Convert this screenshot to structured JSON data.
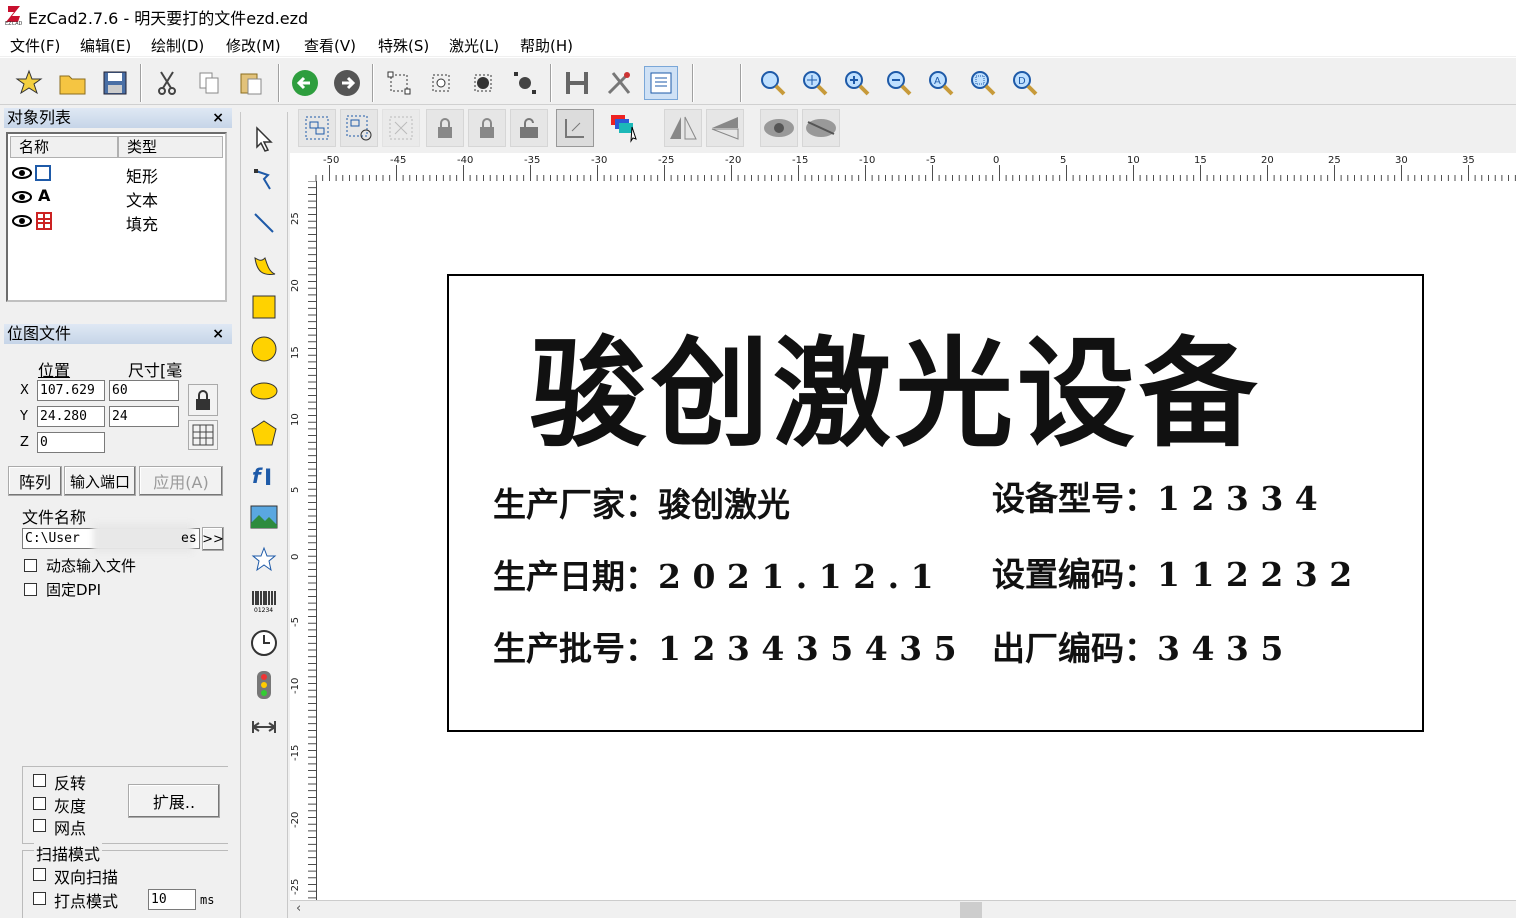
{
  "window": {
    "title": "EzCad2.7.6 - 明天要打的文件ezd.ezd"
  },
  "menu": [
    "文件(F)",
    "编辑(E)",
    "绘制(D)",
    "修改(M)",
    "查看(V)",
    "特殊(S)",
    "激光(L)",
    "帮助(H)"
  ],
  "object_panel": {
    "title": "对象列表",
    "col_name": "名称",
    "col_type": "类型",
    "rows": [
      {
        "icon": "rectangle-icon",
        "type": "矩形"
      },
      {
        "icon": "text-A-icon",
        "type": "文本"
      },
      {
        "icon": "fill-icon",
        "type": "填充"
      }
    ]
  },
  "bitmap_panel": {
    "title": "位图文件",
    "pos_label": "位置",
    "size_label": "尺寸[毫",
    "x_label": "X",
    "y_label": "Y",
    "z_label": "Z",
    "x_pos": "107.629",
    "y_pos": "24.280",
    "z_pos": "0",
    "x_size": "60",
    "y_size": "24",
    "btn_array": "阵列",
    "btn_input_port": "输入端口",
    "btn_apply": "应用(A)",
    "file_name_label": "文件名称",
    "file_path": "C:\\User",
    "file_path_tail": "es",
    "browse": ">>",
    "dynamic_input": "动态输入文件",
    "fixed_dpi": "固定DPI",
    "invert": "反转",
    "gray": "灰度",
    "dither": "网点",
    "btn_expand": "扩展..",
    "scan_mode_label": "扫描模式",
    "bidirectional": "双向扫描",
    "dot_mode": "打点模式",
    "dot_ms_value": "10",
    "ms_unit": "ms"
  },
  "ruler": {
    "h_ticks": [
      "-50",
      "-45",
      "-40",
      "-35",
      "-30",
      "-25",
      "-20",
      "-15",
      "-10",
      "-5",
      "0",
      "5",
      "10",
      "15",
      "20",
      "25",
      "30",
      "35"
    ],
    "v_ticks": [
      "25",
      "20",
      "15",
      "10",
      "5",
      "0",
      "-5",
      "-10",
      "-15",
      "-20",
      "-25"
    ]
  },
  "label_content": {
    "heading": "骏创激光设备",
    "line1_left": "生产厂家：骏创激光",
    "line1_right": "设备型号：1 2 3 3 4",
    "line2_left": "生产日期：2 0 2 1 . 1 2 . 1",
    "line2_right": "设置编码：1 1 2 2 3 2",
    "line3_left": "生产批号：1 2 3 4 3 5 4 3 5",
    "line3_right": "出厂编码：3 4 3 5"
  },
  "colors": {
    "accent_blue": "#1e5aa8",
    "panel_header": "#c6d5e8",
    "shape_yellow": "#ffd200"
  }
}
